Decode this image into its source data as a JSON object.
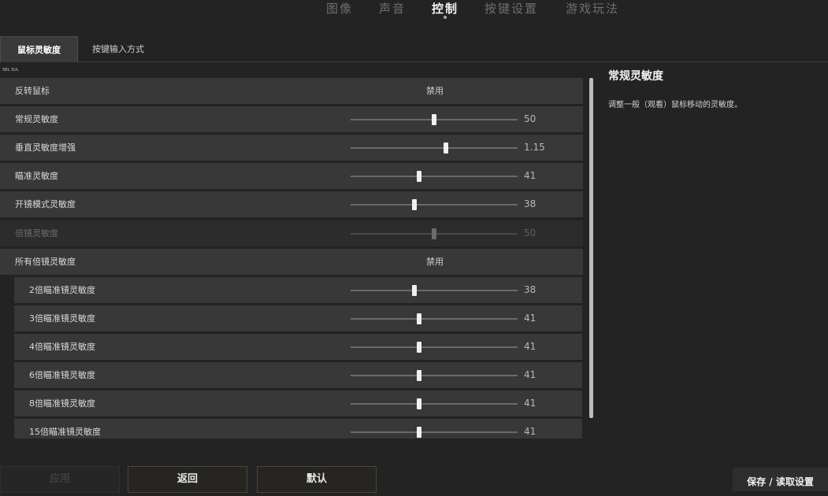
{
  "top_tabs": [
    "图像",
    "声音",
    "控制",
    "按键设置",
    "游戏玩法"
  ],
  "active_top_tab": "控制",
  "sub_tabs": [
    "鼠标灵敏度",
    "按键输入方式"
  ],
  "active_sub_tab": "鼠标灵敏度",
  "tiny_label": "SBL SUL",
  "settings": [
    {
      "label": "反转鼠标",
      "type": "text",
      "value": "禁用"
    },
    {
      "label": "常规灵敏度",
      "type": "slider",
      "value": "50",
      "fraction": 0.5
    },
    {
      "label": "垂直灵敏度增强",
      "type": "slider",
      "value": "1.15",
      "fraction": 0.57
    },
    {
      "label": "瞄准灵敏度",
      "type": "slider",
      "value": "41",
      "fraction": 0.41
    },
    {
      "label": "开镜模式灵敏度",
      "type": "slider",
      "value": "38",
      "fraction": 0.38
    },
    {
      "label": "倍镜灵敏度",
      "type": "slider",
      "value": "50",
      "fraction": 0.5,
      "disabled": true
    },
    {
      "label": "所有倍镜灵敏度",
      "type": "text",
      "value": "禁用"
    },
    {
      "label": "2倍瞄准镜灵敏度",
      "type": "slider",
      "value": "38",
      "fraction": 0.38,
      "sub": true
    },
    {
      "label": "3倍瞄准镜灵敏度",
      "type": "slider",
      "value": "41",
      "fraction": 0.41,
      "sub": true
    },
    {
      "label": "4倍瞄准镜灵敏度",
      "type": "slider",
      "value": "41",
      "fraction": 0.41,
      "sub": true
    },
    {
      "label": "6倍瞄准镜灵敏度",
      "type": "slider",
      "value": "41",
      "fraction": 0.41,
      "sub": true
    },
    {
      "label": "8倍瞄准镜灵敏度",
      "type": "slider",
      "value": "41",
      "fraction": 0.41,
      "sub": true
    },
    {
      "label": "15倍瞄准镜灵敏度",
      "type": "slider",
      "value": "41",
      "fraction": 0.41,
      "sub": true
    }
  ],
  "description": {
    "title": "常规灵敏度",
    "text": "调整一般（观看）鼠标移动的灵敏度。"
  },
  "buttons": {
    "apply": "应用",
    "back": "返回",
    "default": "默认",
    "save_load": "保存 / 读取设置"
  },
  "colors": {
    "background": "#232323",
    "row": "#383838",
    "row_disabled": "#2c2c2c",
    "handle": "#f0f0f0",
    "button_border": "#4a463c"
  }
}
